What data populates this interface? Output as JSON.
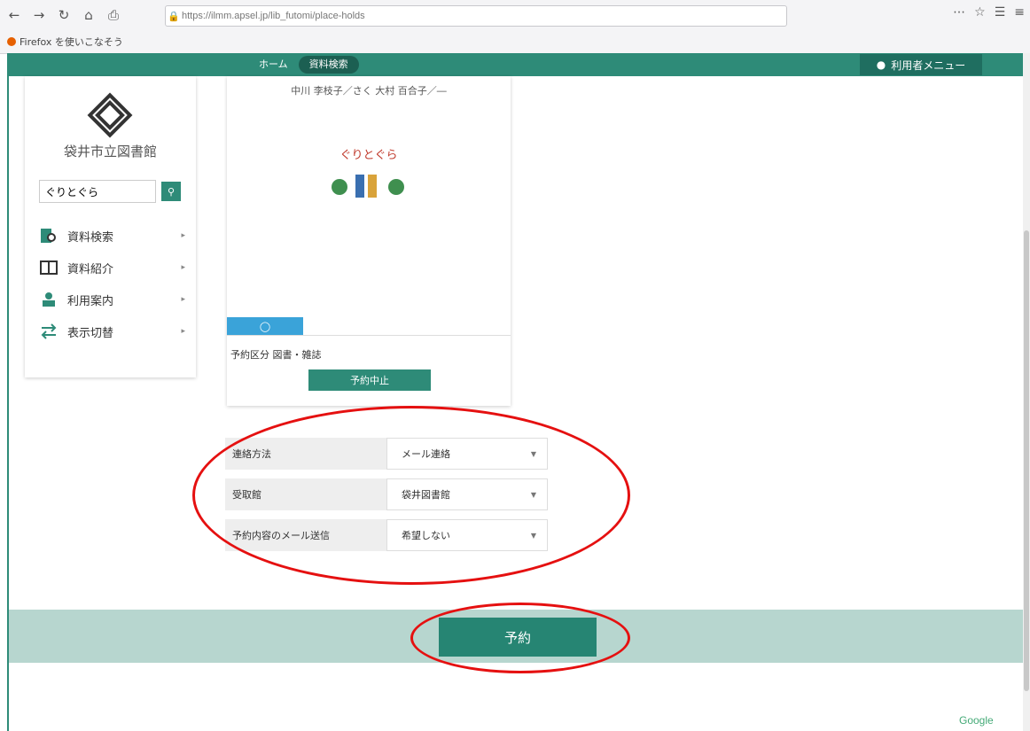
{
  "browser": {
    "url": "https://ilmm.apsel.jp/lib_futomi/place-holds",
    "bookmark": "Firefox を使いこなそう"
  },
  "header": {
    "crumbs": [
      "ホーム",
      "資料検索"
    ],
    "user_menu": "利用者メニュー"
  },
  "sidebar": {
    "library_name": "袋井市立図書館",
    "search_value": "ぐりとぐら",
    "items": [
      {
        "label": "資料検索",
        "icon": "search-document-icon"
      },
      {
        "label": "資料紹介",
        "icon": "book-open-icon"
      },
      {
        "label": "利用案内",
        "icon": "user-guide-icon"
      },
      {
        "label": "表示切替",
        "icon": "switch-arrows-icon"
      }
    ]
  },
  "card": {
    "authors": "中川 李枝子／さく 大村 百合子／―",
    "cover_title": "ぐりとぐら",
    "reservation_type": "予約区分 図書・雑誌",
    "cancel_label": "予約中止"
  },
  "form": {
    "rows": [
      {
        "label": "連絡方法",
        "value": "メール連絡"
      },
      {
        "label": "受取館",
        "value": "袋井図書館"
      },
      {
        "label": "予約内容のメール送信",
        "value": "希望しない"
      }
    ]
  },
  "actions": {
    "reserve_label": "予約"
  },
  "colors": {
    "brand": "#2e8b78",
    "highlight": "#e51010",
    "band": "#b7d6cf"
  }
}
